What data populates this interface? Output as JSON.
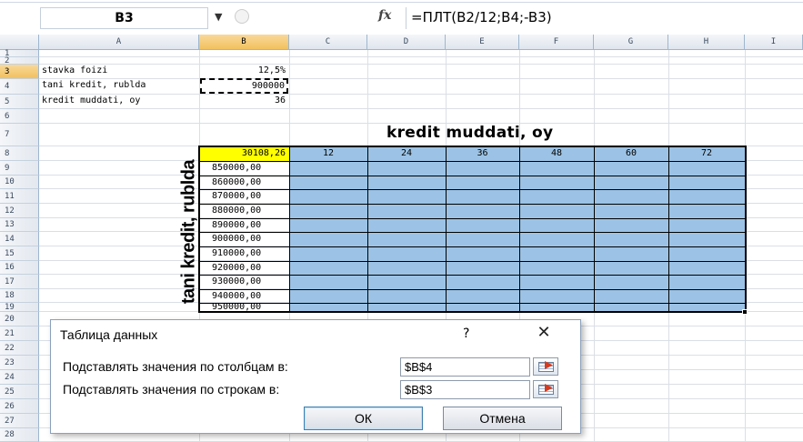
{
  "formula_bar": {
    "name_box": "B3",
    "fx": "fx",
    "formula": "=ПЛТ(B2/12;B4;-B3)"
  },
  "columns": [
    "A",
    "B",
    "C",
    "D",
    "E",
    "F",
    "G",
    "H",
    "I"
  ],
  "rows": [
    "1",
    "2",
    "3",
    "4",
    "5",
    "6",
    "7",
    "8",
    "9",
    "10",
    "11",
    "12",
    "13",
    "14",
    "15",
    "16",
    "17",
    "18",
    "19",
    "20",
    "21",
    "22",
    "23",
    "24",
    "25",
    "26",
    "27",
    "28"
  ],
  "params": {
    "rate_label": "stavka foizi",
    "rate_value": "12,5%",
    "loan_label": "tani kredit, rublda",
    "loan_value": "900000",
    "term_label": "kredit muddati, oy",
    "term_value": "36"
  },
  "table": {
    "title": "kredit muddati, oy",
    "side_label": "tani kredit, rublda",
    "corner": "30108,26",
    "terms": [
      "12",
      "24",
      "36",
      "48",
      "60",
      "72"
    ],
    "amounts": [
      "850000,00",
      "860000,00",
      "870000,00",
      "880000,00",
      "890000,00",
      "900000,00",
      "910000,00",
      "920000,00",
      "930000,00",
      "940000,00",
      "950000,00"
    ]
  },
  "dialog": {
    "title": "Таблица данных",
    "help": "?",
    "close": "✕",
    "cols_label": "Подставлять значения по столбцам в:",
    "cols_value": "$B$4",
    "rows_label": "Подставлять значения по строкам в:",
    "rows_value": "$B$3",
    "ok": "ОК",
    "cancel": "Отмена"
  },
  "colors": {
    "table_fill": "#9cc3e5",
    "selected_header": "#f1c15f",
    "corner_fill": "#ffff00"
  }
}
